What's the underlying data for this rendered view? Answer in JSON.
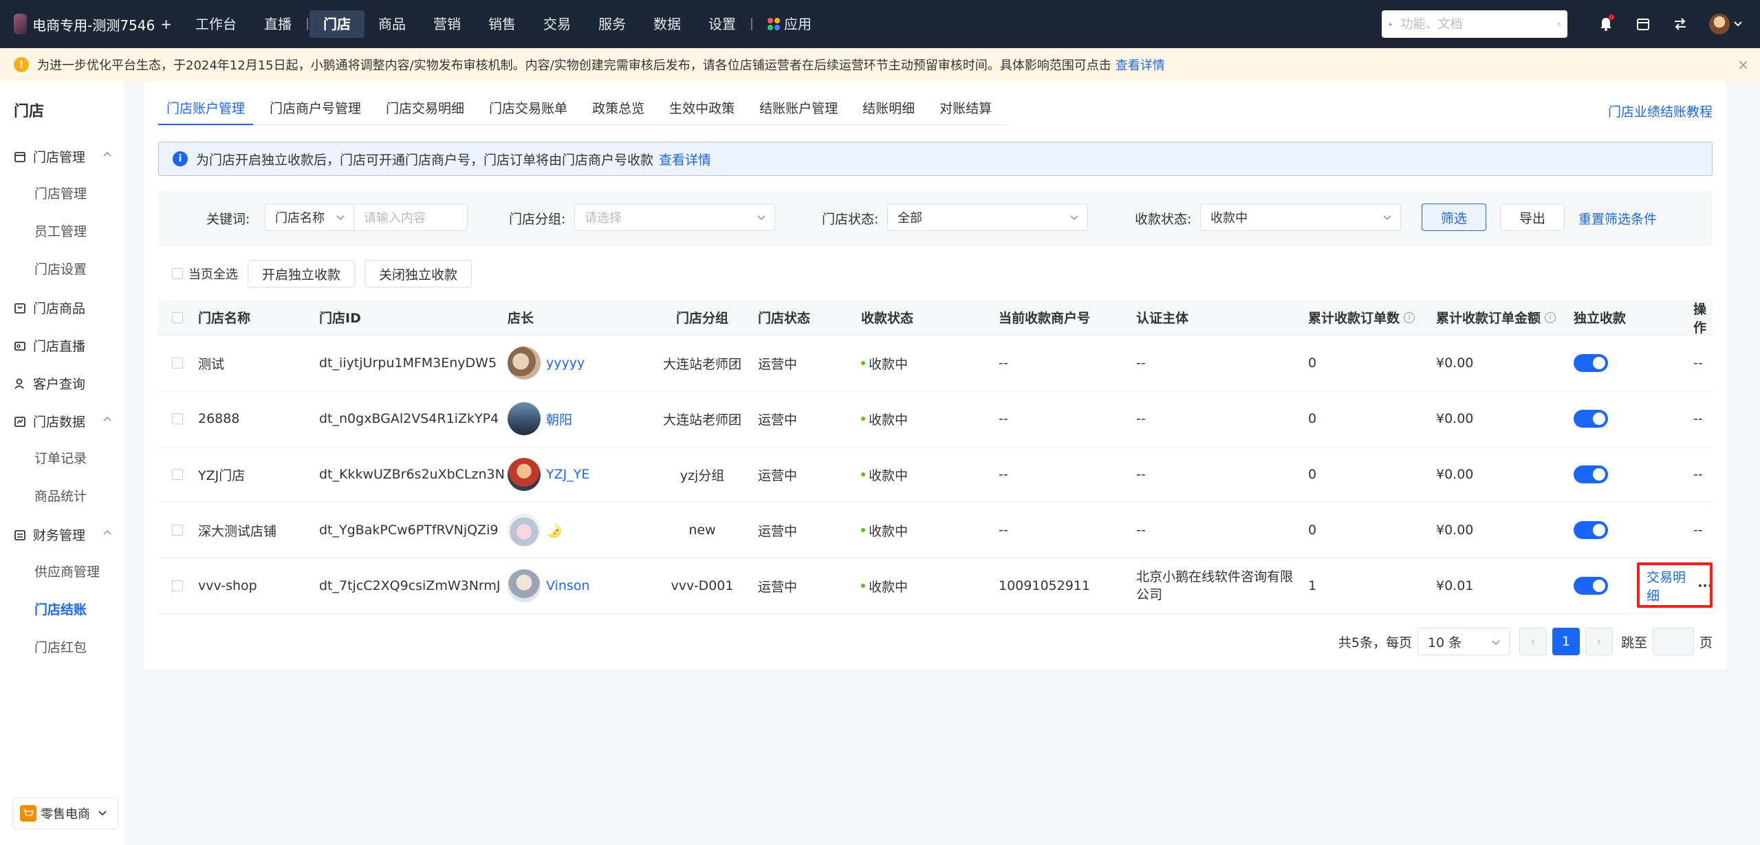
{
  "topnav": {
    "store_name": "电商专用-测测7546",
    "add": "+",
    "items": [
      {
        "label": "工作台"
      },
      {
        "label": "直播"
      },
      {
        "label": "门店",
        "active": true
      },
      {
        "label": "商品"
      },
      {
        "label": "营销"
      },
      {
        "label": "销售"
      },
      {
        "label": "交易"
      },
      {
        "label": "服务"
      },
      {
        "label": "数据"
      },
      {
        "label": "设置"
      },
      {
        "label": "应用"
      }
    ],
    "search_placeholder": "功能、文档"
  },
  "banner": {
    "text": "为进一步优化平台生态，于2024年12月15日起，小鹅通将调整内容/实物发布审核机制。内容/实物创建完需审核后发布，请各位店铺运营者在后续运营环节主动预留审核时间。具体影响范围可点击",
    "link": "查看详情",
    "close": "×"
  },
  "sidebar": {
    "title": "门店",
    "groups": [
      {
        "label": "门店管理",
        "icon": "store-icon",
        "items": [
          "门店管理",
          "员工管理",
          "门店设置"
        ]
      },
      {
        "label": "门店商品",
        "icon": "bag-icon",
        "items": []
      },
      {
        "label": "门店直播",
        "icon": "live-icon",
        "items": []
      },
      {
        "label": "客户查询",
        "icon": "user-icon",
        "items": []
      },
      {
        "label": "门店数据",
        "icon": "chart-icon",
        "items": [
          "订单记录",
          "商品统计"
        ]
      },
      {
        "label": "财务管理",
        "icon": "finance-icon",
        "items": [
          "供应商管理",
          "门店结账",
          "门店红包"
        ]
      }
    ],
    "active_item": "门店结账",
    "bottom_switch": "零售电商"
  },
  "tabs": [
    {
      "label": "门店账户管理",
      "active": true
    },
    {
      "label": "门店商户号管理"
    },
    {
      "label": "门店交易明细"
    },
    {
      "label": "门店交易账单"
    },
    {
      "label": "政策总览"
    },
    {
      "label": "生效中政策"
    },
    {
      "label": "结账账户管理"
    },
    {
      "label": "结账明细"
    },
    {
      "label": "对账结算"
    }
  ],
  "tutorial_link": "门店业绩结账教程",
  "info": {
    "text": "为门店开启独立收款后，门店可开通门店商户号，门店订单将由门店商户号收款",
    "link": "查看详情"
  },
  "filters": {
    "keyword_label": "关键词:",
    "keyword_type": "门店名称",
    "keyword_placeholder": "请输入内容",
    "group_label": "门店分组:",
    "group_placeholder": "请选择",
    "status_label": "门店状态:",
    "status_value": "全部",
    "pay_label": "收款状态:",
    "pay_value": "收款中",
    "filter_btn": "筛选",
    "export_btn": "导出",
    "reset_link": "重置筛选条件"
  },
  "batch": {
    "select_all": "当页全选",
    "enable": "开启独立收款",
    "disable": "关闭独立收款"
  },
  "table": {
    "headers": [
      "门店名称",
      "门店ID",
      "店长",
      "门店分组",
      "门店状态",
      "收款状态",
      "当前收款商户号",
      "认证主体",
      "累计收款订单数",
      "累计收款订单金额",
      "独立收款",
      "操作"
    ],
    "rows": [
      {
        "name": "测试",
        "id": "dt_iiytjUrpu1MFM3EnyDW5",
        "manager": "yyyyy",
        "group": "大连站老师团",
        "status": "运营中",
        "pay": "收款中",
        "merchant": "--",
        "entity": "--",
        "orders": "0",
        "amount": "¥0.00",
        "op": "--"
      },
      {
        "name": "26888",
        "id": "dt_n0gxBGAl2VS4R1iZkYP4",
        "manager": "朝阳",
        "group": "大连站老师团",
        "status": "运营中",
        "pay": "收款中",
        "merchant": "--",
        "entity": "--",
        "orders": "0",
        "amount": "¥0.00",
        "op": "--"
      },
      {
        "name": "YZJ门店",
        "id": "dt_KkkwUZBr6s2uXbCLzn3N",
        "manager": "YZJ_YE",
        "group": "yzj分组",
        "status": "运营中",
        "pay": "收款中",
        "merchant": "--",
        "entity": "--",
        "orders": "0",
        "amount": "¥0.00",
        "op": "--"
      },
      {
        "name": "深大测试店铺",
        "id": "dt_YgBakPCw6PTfRVNjQZi9",
        "manager": "🌛",
        "group": "new",
        "status": "运营中",
        "pay": "收款中",
        "merchant": "--",
        "entity": "--",
        "orders": "0",
        "amount": "¥0.00",
        "op": "--"
      },
      {
        "name": "vvv-shop",
        "id": "dt_7tjcC2XQ9csiZmW3NrmJ",
        "manager": "Vinson",
        "group": "vvv-D001",
        "status": "运营中",
        "pay": "收款中",
        "merchant": "10091052911",
        "entity_line1": "北京小鹅在线软件咨询有限",
        "entity_line2": "公司",
        "orders": "1",
        "amount": "¥0.01",
        "op": "交易明细",
        "more": "···"
      }
    ]
  },
  "pager": {
    "total": "共5条，每页",
    "page_size": "10 条",
    "current": "1",
    "jump": "跳至",
    "page_unit": "页",
    "prev": "‹",
    "next": "›"
  },
  "colors": {
    "accent": "#1966ff",
    "nav_bg": "#1d2636",
    "highlight": "#ff1a1a",
    "success": "#52c41a"
  }
}
